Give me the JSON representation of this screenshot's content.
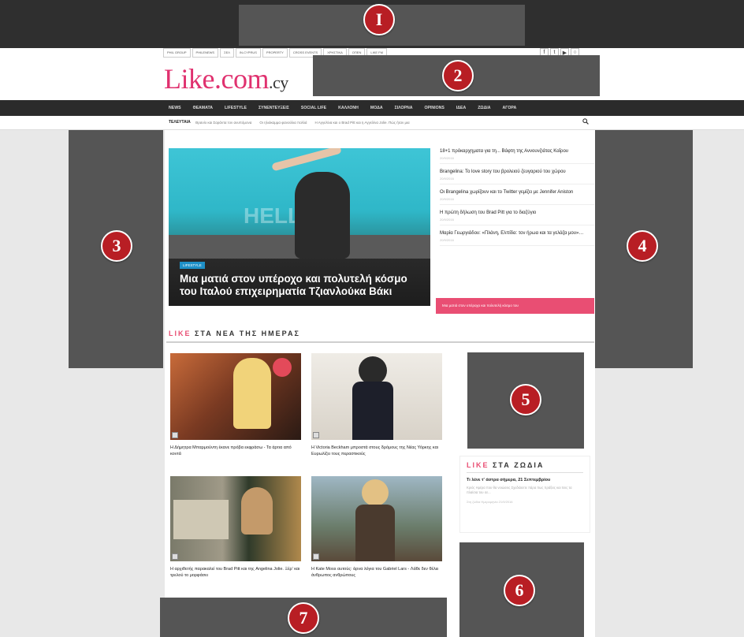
{
  "network_links": [
    "PHIL GROUP",
    "PHILENEWS",
    "ΣΕΛ",
    "IN-CYPRUS",
    "PROPERTY",
    "CROSS EVENTS",
    "ΧΡΗΣΤΙΚΑ",
    "ΟΠΕΝ",
    "LIKE FM"
  ],
  "social": {
    "facebook": "f",
    "twitter": "t",
    "youtube": "▶",
    "other": "○"
  },
  "logo": {
    "main": "Like.com",
    "suffix": ".cy"
  },
  "nav": [
    "NEWS",
    "ΘΕΑΜΑΤΑ",
    "LIFESTYLE",
    "ΣΥΝΕΝΤΕΥΞΕΙΣ",
    "SOCIAL LIFE",
    "ΚΑΛΛΟΝΗ",
    "ΜΟΔΑ",
    "ΣΙΛΟΡΝΑ",
    "OPINIONS",
    "ΙΔΕΑ",
    "ΖΩΔΙΑ",
    "ΑΓΟΡΑ"
  ],
  "ticker": {
    "label": "ΤΕΛΕΥΤΑΙΑ",
    "items": [
      "Θρανίο και Σαράντα τον ανυπόμονα",
      "Οι ηλιόκαμμα φανούλια πολλά",
      "Η Αγγελίνα και ο Brad Pitt και η Αγγελίνα Jolie. Πώς ήταν μια"
    ]
  },
  "hero": {
    "category": "LIFESTYLE",
    "watermark": "HELLO!",
    "headline": "Μια ματιά στον υπέροχο και πολυτελή κόσμο του Ιταλού επιχειρηματία Τζιανλούκα Βάκι"
  },
  "side_list": [
    {
      "title": "18+1 πρόκαρχηματα για τη... Βάφτη της Αννουνζιάτας Καΐρου",
      "date": "20/9/2016"
    },
    {
      "title": "Brangelina: Το love story του βρολειού ζευγαριού του χώρου",
      "date": "20/9/2016"
    },
    {
      "title": "Οι Brangelina χωρίζουν και το Twitter γεμίζει με Jennifer Aniston",
      "date": "20/9/2016"
    },
    {
      "title": "Η πρώτη δήλωση του Brad Pitt για το διαζύγιο",
      "date": "20/9/2016"
    },
    {
      "title": "Μαρία Γεωργιάδου: «Πλάνη, Ελπίδα: τον ήρωα και τα γελάζα μου»…",
      "date": "20/9/2016"
    }
  ],
  "side_button": "Μια ματιά στον υπέροχο και πολυτελή κόσμο του",
  "section": {
    "pink": "LIKE",
    "rest": " ΣΤΑ ΝΕΑ ΤΗΣ ΗΜΕΡΑΣ"
  },
  "cards": [
    {
      "caption": "Η Δήμητρα Μπαρμούντη έκανε πρόβα εκφράσω - Τα άρτια από κοντά"
    },
    {
      "caption": "Η Victoria Beckham μπροστά στους δρόμους της Νέας Υόρκης και Ευρωλίζει τους περαστικούς"
    },
    {
      "caption": "Η αρχιθετής παρακαλεί του Brad Pitt και της Angelina Jolie. Ξέρ' και τρελού το μορφάσει"
    },
    {
      "caption": "Η Kate Moss αυτούς: άρνα λόγια του Gabriel Lars - Λάθε δεν θέλει άνθρωπος ανθρώπους"
    }
  ],
  "zodia": {
    "pink": "LIKE",
    "rest": " ΣΤΑ ΖΩΔΙΑ",
    "headline": "Τι λένε τ' άστρα σήμερα, 21 Σεπτεμβρίου",
    "text": "Κριός Ημέρα που θα νοιώσεις Σχεδιάσετε πάρα πως πράξεις και πεις τα πλαίσια του σε...",
    "meta": "Στη ζώδια    Ημερομηνία 21/9/2016"
  },
  "markers": [
    "I",
    "2",
    "3",
    "4",
    "5",
    "6",
    "7"
  ]
}
